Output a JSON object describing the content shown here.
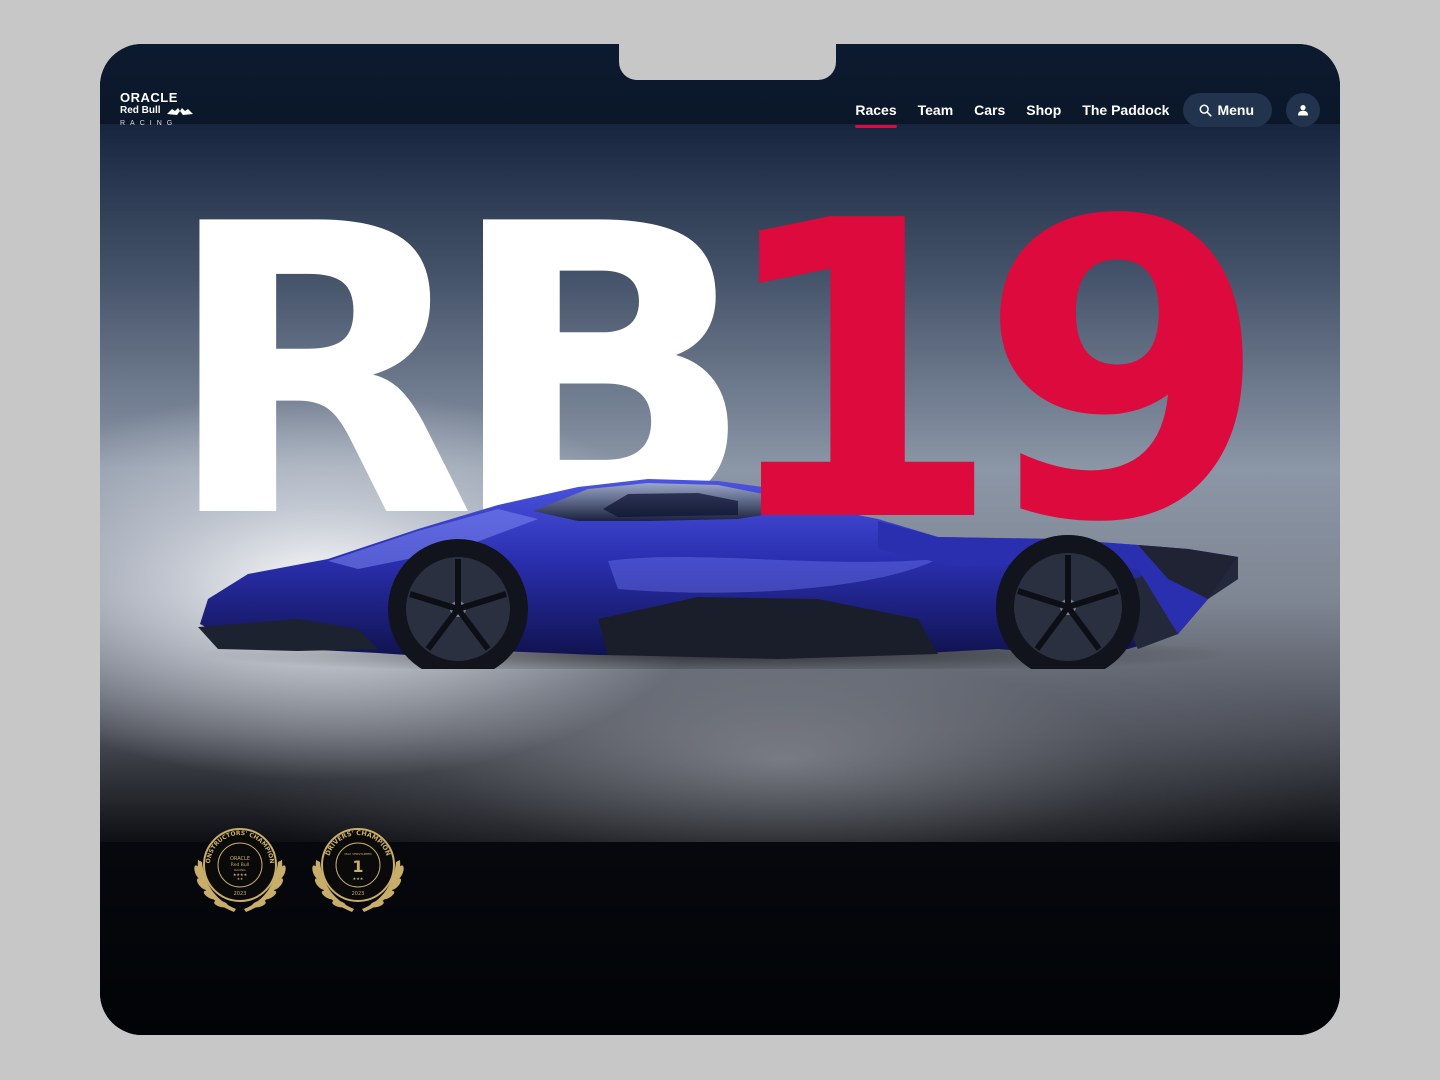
{
  "brand": {
    "line1": "ORACLE",
    "line2": "Red Bull",
    "line3": "RACING"
  },
  "nav": {
    "items": [
      {
        "label": "Races",
        "active": true
      },
      {
        "label": "Team",
        "active": false
      },
      {
        "label": "Cars",
        "active": false
      },
      {
        "label": "Shop",
        "active": false
      },
      {
        "label": "The Paddock",
        "active": false
      }
    ],
    "menu_label": "Menu",
    "menu_icon": "search-icon",
    "user_icon": "user-icon"
  },
  "hero": {
    "title_part1": "RB",
    "title_part2": "19",
    "title_part2_color": "#dc0a3d",
    "car_color": "#2a2fb0"
  },
  "badges": [
    {
      "ring_text": "CONSTRUCTORS' CHAMPIONS",
      "center_line1": "ORACLE",
      "center_line2": "Red Bull",
      "center_line3": "RACING",
      "stars": "★★★★",
      "stars2": "★★",
      "year": "2023"
    },
    {
      "ring_text": "DRIVERS' CHAMPION",
      "center_line1": "MAX VERSTAPPEN",
      "center_number": "1",
      "stars": "★★★",
      "year": "2023"
    }
  ],
  "colors": {
    "accent": "#dc0a3d",
    "nav_bg": "#0c1a30",
    "pill_bg": "#22334e",
    "gold": "#c8ad6b"
  }
}
